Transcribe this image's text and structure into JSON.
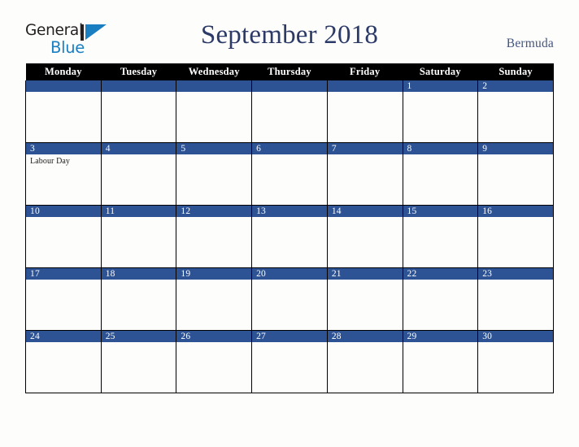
{
  "brand": {
    "name_part1": "General",
    "name_part2": "Blue",
    "mark_icon": "blue-triangle-flag-icon"
  },
  "header": {
    "title": "September 2018",
    "country": "Bermuda"
  },
  "colors": {
    "page_background": "#fdfdfb",
    "header_row_background": "#000000",
    "header_row_text": "#ffffff",
    "date_band": "#2d5395",
    "date_band_text": "#ffffff",
    "title_text": "#2c3a68",
    "country_text": "#445480",
    "logo_dark": "#231f20",
    "logo_blue": "#1a7fc1",
    "cell_background": "#fdfdfc",
    "cell_border": "#000000",
    "event_text": "#1a1a1a"
  },
  "weekdays": [
    {
      "label": "Monday"
    },
    {
      "label": "Tuesday"
    },
    {
      "label": "Wednesday"
    },
    {
      "label": "Thursday"
    },
    {
      "label": "Friday"
    },
    {
      "label": "Saturday"
    },
    {
      "label": "Sunday"
    }
  ],
  "weeks": [
    [
      {
        "day": "",
        "events": []
      },
      {
        "day": "",
        "events": []
      },
      {
        "day": "",
        "events": []
      },
      {
        "day": "",
        "events": []
      },
      {
        "day": "",
        "events": []
      },
      {
        "day": "1",
        "events": []
      },
      {
        "day": "2",
        "events": []
      }
    ],
    [
      {
        "day": "3",
        "events": [
          "Labour Day"
        ]
      },
      {
        "day": "4",
        "events": []
      },
      {
        "day": "5",
        "events": []
      },
      {
        "day": "6",
        "events": []
      },
      {
        "day": "7",
        "events": []
      },
      {
        "day": "8",
        "events": []
      },
      {
        "day": "9",
        "events": []
      }
    ],
    [
      {
        "day": "10",
        "events": []
      },
      {
        "day": "11",
        "events": []
      },
      {
        "day": "12",
        "events": []
      },
      {
        "day": "13",
        "events": []
      },
      {
        "day": "14",
        "events": []
      },
      {
        "day": "15",
        "events": []
      },
      {
        "day": "16",
        "events": []
      }
    ],
    [
      {
        "day": "17",
        "events": []
      },
      {
        "day": "18",
        "events": []
      },
      {
        "day": "19",
        "events": []
      },
      {
        "day": "20",
        "events": []
      },
      {
        "day": "21",
        "events": []
      },
      {
        "day": "22",
        "events": []
      },
      {
        "day": "23",
        "events": []
      }
    ],
    [
      {
        "day": "24",
        "events": []
      },
      {
        "day": "25",
        "events": []
      },
      {
        "day": "26",
        "events": []
      },
      {
        "day": "27",
        "events": []
      },
      {
        "day": "28",
        "events": []
      },
      {
        "day": "29",
        "events": []
      },
      {
        "day": "30",
        "events": []
      }
    ]
  ]
}
